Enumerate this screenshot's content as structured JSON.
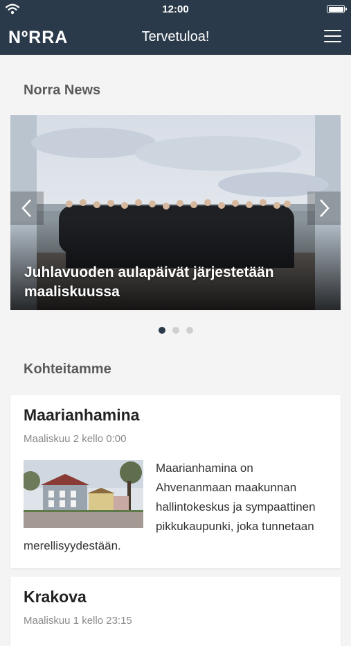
{
  "status_bar": {
    "time": "12:00"
  },
  "nav": {
    "logo": "NºRRA",
    "title": "Tervetuloa!"
  },
  "news": {
    "section_title": "Norra News",
    "slide_caption": "Juhlavuoden aulapäivät järjestetään maaliskuussa",
    "slide_count": 3,
    "active_slide": 1
  },
  "destinations": {
    "section_title": "Kohteitamme",
    "cards": [
      {
        "title": "Maarianhamina",
        "date": "Maaliskuu 2 kello 0:00",
        "text": "Maarianhamina on Ahvenanmaan maakunnan hallintokeskus ja sympaattinen pikkukaupunki, joka tunnetaan merellisyydestään."
      },
      {
        "title": "Krakova",
        "date": "Maaliskuu 1 kello 23:15"
      }
    ]
  },
  "colors": {
    "brand": "#2b3a4a",
    "dot_active": "#2b3a4a",
    "dot_inactive": "#cfcfcf"
  }
}
